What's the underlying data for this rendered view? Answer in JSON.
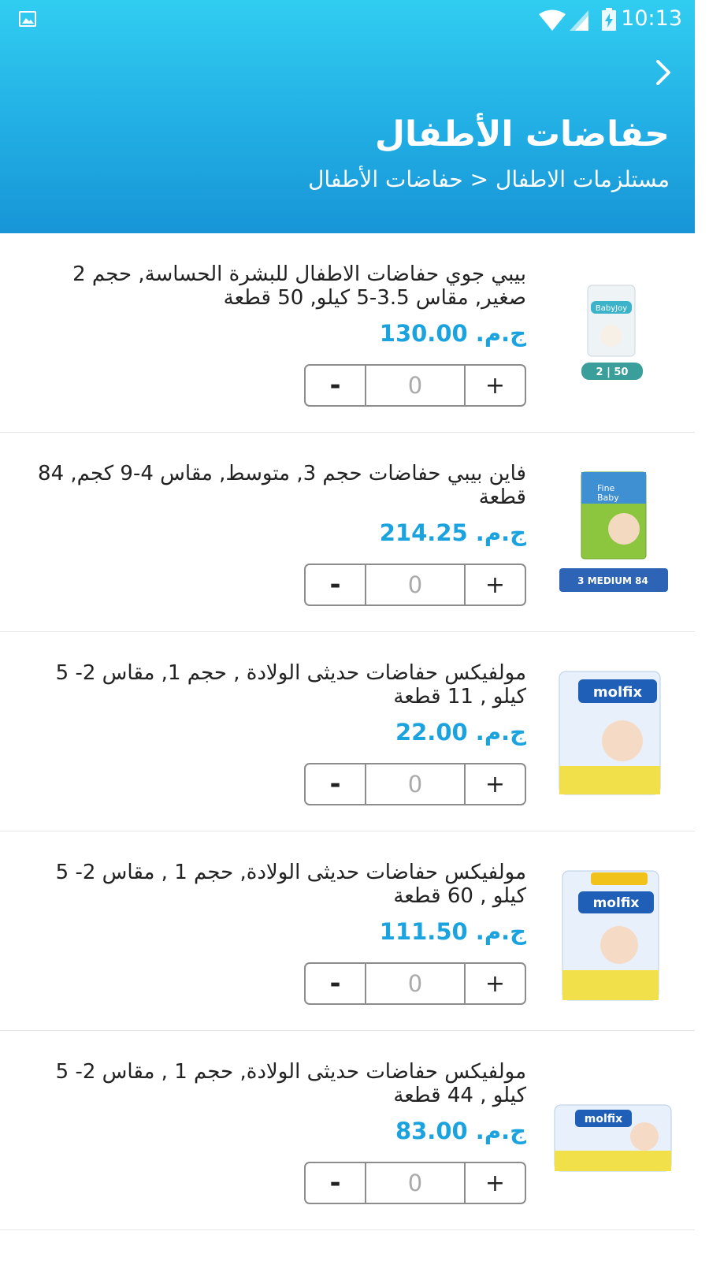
{
  "status_bar": {
    "time": "10:13"
  },
  "header": {
    "title": "حفاضات الأطفال",
    "breadcrumb": "مستلزمات الاطفال < حفاضات الأطفال"
  },
  "icons": {
    "back": "chevron-right-icon",
    "gallery": "image-icon",
    "wifi": "wifi-icon",
    "signal": "signal-icon",
    "battery": "battery-charging-icon"
  },
  "colors": {
    "header_top": "#31cdf1",
    "header_bottom": "#1795d6",
    "price": "#1ba3e0"
  },
  "currency": "ج.م.",
  "stepper": {
    "minus": "-",
    "plus": "+"
  },
  "products": [
    {
      "name": "بيبي جوي حفاضات الاطفال للبشرة الحساسة, حجم 2 صغير, مقاس 3.5-5 كيلو, 50 قطعة",
      "price": "130.00",
      "qty": "0",
      "pack_label": "2 | 50"
    },
    {
      "name": "فاين بيبي حفاضات حجم 3, متوسط, مقاس 4-9 كجم, 84 قطعة",
      "price": "214.25",
      "qty": "0",
      "pack_label": "3 MEDIUM 84"
    },
    {
      "name": "مولفيكس حفاضات حديثى الولادة , حجم 1, مقاس 2- 5 كيلو , 11 قطعة",
      "price": "22.00",
      "qty": "0",
      "pack_label": "molfix"
    },
    {
      "name": "مولفيكس حفاضات حديثى الولادة, حجم 1 , مقاس 2- 5 كيلو , 60 قطعة",
      "price": "111.50",
      "qty": "0",
      "pack_label": "molfix"
    },
    {
      "name": "مولفيكس حفاضات حديثى الولادة, حجم 1 , مقاس 2- 5 كيلو , 44 قطعة",
      "price": "83.00",
      "qty": "0",
      "pack_label": "molfix"
    }
  ]
}
